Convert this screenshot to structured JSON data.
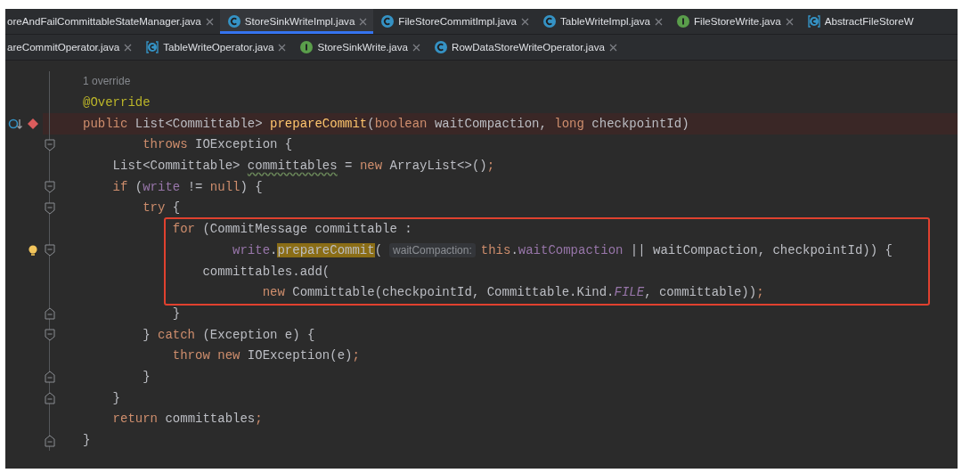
{
  "tab_rows": [
    [
      {
        "label": "oreAndFailCommittableStateManager.java",
        "selected": false,
        "closable": true
      },
      {
        "label": "StoreSinkWriteImpl.java",
        "kind": "class",
        "selected": true,
        "closable": true
      },
      {
        "label": "FileStoreCommitImpl.java",
        "kind": "class",
        "selected": false,
        "closable": true
      },
      {
        "label": "TableWriteImpl.java",
        "kind": "class",
        "selected": false,
        "closable": true
      },
      {
        "label": "FileStoreWrite.java",
        "kind": "interface",
        "selected": false,
        "closable": true
      },
      {
        "label": "AbstractFileStoreW",
        "kind": "abstract",
        "selected": false,
        "closable": false
      }
    ],
    [
      {
        "label": "areCommitOperator.java",
        "selected": false,
        "closable": true
      },
      {
        "label": "TableWriteOperator.java",
        "kind": "abstract",
        "selected": false,
        "closable": true
      },
      {
        "label": "StoreSinkWrite.java",
        "kind": "interface",
        "selected": false,
        "closable": true
      },
      {
        "label": "RowDataStoreWriteOperator.java",
        "kind": "class",
        "selected": false,
        "closable": true
      }
    ]
  ],
  "code_lines": [
    {
      "breakpoint": false,
      "boxed": false,
      "tokens": [
        {
          "kind": "codevision",
          "text": "1 override"
        }
      ]
    },
    {
      "breakpoint": false,
      "boxed": false,
      "tokens": [
        {
          "kind": "annotation",
          "text": "@Override"
        }
      ]
    },
    {
      "breakpoint": true,
      "boxed": false,
      "gutter_icon": {
        "kind": "override"
      },
      "tokens": [
        {
          "kind": "keyword",
          "text": "public "
        },
        {
          "kind": "plain",
          "text": "List<Committable> "
        },
        {
          "kind": "method",
          "text": "prepareCommit"
        },
        {
          "kind": "plain",
          "text": "("
        },
        {
          "kind": "keyword",
          "text": "boolean "
        },
        {
          "kind": "plain",
          "text": "waitCompaction, "
        },
        {
          "kind": "keyword",
          "text": "long "
        },
        {
          "kind": "plain",
          "text": "checkpointId)"
        }
      ]
    },
    {
      "breakpoint": false,
      "boxed": false,
      "fold": {
        "kind": "start"
      },
      "tokens": [
        {
          "kind": "keyword",
          "text": "        throws "
        },
        {
          "kind": "plain",
          "text": "IOException {"
        }
      ]
    },
    {
      "breakpoint": false,
      "boxed": false,
      "tokens": [
        {
          "kind": "plain",
          "text": "    List<Committable> "
        },
        {
          "kind": "warning",
          "text": "committables"
        },
        {
          "kind": "plain",
          "text": " = "
        },
        {
          "kind": "keyword",
          "text": "new "
        },
        {
          "kind": "plain",
          "text": "ArrayList<>()"
        },
        {
          "kind": "keyword",
          "text": ";"
        }
      ]
    },
    {
      "breakpoint": false,
      "boxed": false,
      "fold": {
        "kind": "start"
      },
      "tokens": [
        {
          "kind": "keyword",
          "text": "    if "
        },
        {
          "kind": "plain",
          "text": "("
        },
        {
          "kind": "field",
          "text": "write"
        },
        {
          "kind": "plain",
          "text": " != "
        },
        {
          "kind": "keyword",
          "text": "null"
        },
        {
          "kind": "plain",
          "text": ") {"
        }
      ]
    },
    {
      "breakpoint": false,
      "boxed": false,
      "fold": {
        "kind": "start"
      },
      "tokens": [
        {
          "kind": "keyword",
          "text": "        try "
        },
        {
          "kind": "plain",
          "text": "{"
        }
      ]
    },
    {
      "breakpoint": false,
      "boxed": true,
      "tokens": [
        {
          "kind": "keyword",
          "text": "            for "
        },
        {
          "kind": "plain",
          "text": "(CommitMessage committable :"
        }
      ]
    },
    {
      "breakpoint": false,
      "boxed": true,
      "fold": {
        "kind": "start"
      },
      "gutter_icon": {
        "kind": "bulb"
      },
      "tokens": [
        {
          "kind": "field",
          "text": "                    write"
        },
        {
          "kind": "plain",
          "text": "."
        },
        {
          "kind": "selected-method",
          "text": "prepareCommit"
        },
        {
          "kind": "plain",
          "text": "("
        },
        {
          "kind": "inlay",
          "text": "waitCompaction:"
        },
        {
          "kind": "keyword",
          "text": "this"
        },
        {
          "kind": "plain",
          "text": "."
        },
        {
          "kind": "field",
          "text": "waitCompaction"
        },
        {
          "kind": "plain",
          "text": " || waitCompaction, checkpointId)) {"
        }
      ]
    },
    {
      "breakpoint": false,
      "boxed": true,
      "tokens": [
        {
          "kind": "plain",
          "text": "                committables.add("
        }
      ]
    },
    {
      "breakpoint": false,
      "boxed": true,
      "tokens": [
        {
          "kind": "keyword",
          "text": "                        new "
        },
        {
          "kind": "plain",
          "text": "Committable(checkpointId, Committable.Kind."
        },
        {
          "kind": "constant",
          "text": "FILE"
        },
        {
          "kind": "plain",
          "text": ", committable))"
        },
        {
          "kind": "keyword",
          "text": ";"
        }
      ]
    },
    {
      "breakpoint": false,
      "boxed": false,
      "fold": {
        "kind": "end"
      },
      "tokens": [
        {
          "kind": "plain",
          "text": "            }"
        }
      ]
    },
    {
      "breakpoint": false,
      "boxed": false,
      "fold": {
        "kind": "start"
      },
      "tokens": [
        {
          "kind": "plain",
          "text": "        } "
        },
        {
          "kind": "keyword",
          "text": "catch "
        },
        {
          "kind": "plain",
          "text": "(Exception e) {"
        }
      ]
    },
    {
      "breakpoint": false,
      "boxed": false,
      "tokens": [
        {
          "kind": "keyword",
          "text": "            throw new "
        },
        {
          "kind": "plain",
          "text": "IOException(e)"
        },
        {
          "kind": "keyword",
          "text": ";"
        }
      ]
    },
    {
      "breakpoint": false,
      "boxed": false,
      "fold": {
        "kind": "end"
      },
      "tokens": [
        {
          "kind": "plain",
          "text": "        }"
        }
      ]
    },
    {
      "breakpoint": false,
      "boxed": false,
      "fold": {
        "kind": "end"
      },
      "tokens": [
        {
          "kind": "plain",
          "text": "    }"
        }
      ]
    },
    {
      "breakpoint": false,
      "boxed": false,
      "tokens": [
        {
          "kind": "keyword",
          "text": "    return "
        },
        {
          "kind": "plain",
          "text": "committables"
        },
        {
          "kind": "keyword",
          "text": ";"
        }
      ]
    },
    {
      "breakpoint": false,
      "boxed": false,
      "fold": {
        "kind": "end"
      },
      "tokens": [
        {
          "kind": "plain",
          "text": "}"
        }
      ]
    }
  ]
}
